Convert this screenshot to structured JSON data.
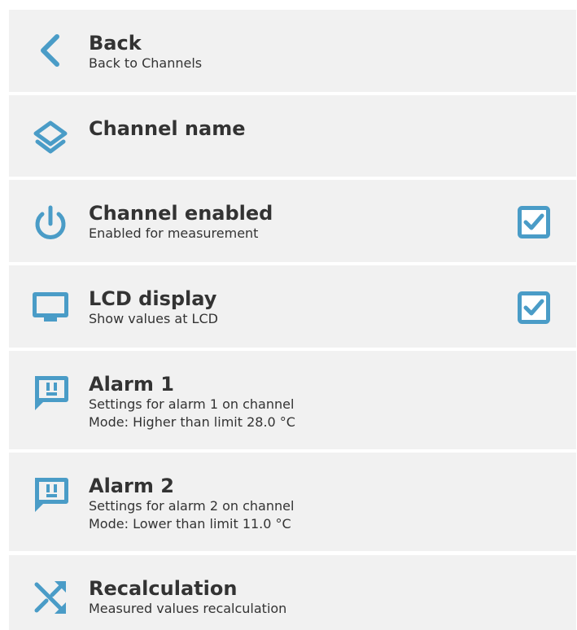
{
  "accent_color": "#4a9cc7",
  "items": [
    {
      "icon": "chevron-left-icon",
      "title": "Back",
      "lines": [
        "Back to Channels"
      ]
    },
    {
      "icon": "layers-icon",
      "title": "Channel name",
      "lines": []
    },
    {
      "icon": "power-icon",
      "title": "Channel enabled",
      "lines": [
        "Enabled for measurement"
      ],
      "checked": true
    },
    {
      "icon": "monitor-icon",
      "title": "LCD display",
      "lines": [
        "Show values at LCD"
      ],
      "checked": true
    },
    {
      "icon": "alert-message-icon",
      "title": "Alarm 1",
      "lines": [
        "Settings for alarm 1 on channel",
        "Mode: Higher than limit 28.0 °C"
      ]
    },
    {
      "icon": "alert-message-icon",
      "title": "Alarm 2",
      "lines": [
        "Settings for alarm 2 on channel",
        "Mode: Lower than limit 11.0 °C"
      ]
    },
    {
      "icon": "shuffle-icon",
      "title": "Recalculation",
      "lines": [
        "Measured values recalculation"
      ]
    }
  ]
}
